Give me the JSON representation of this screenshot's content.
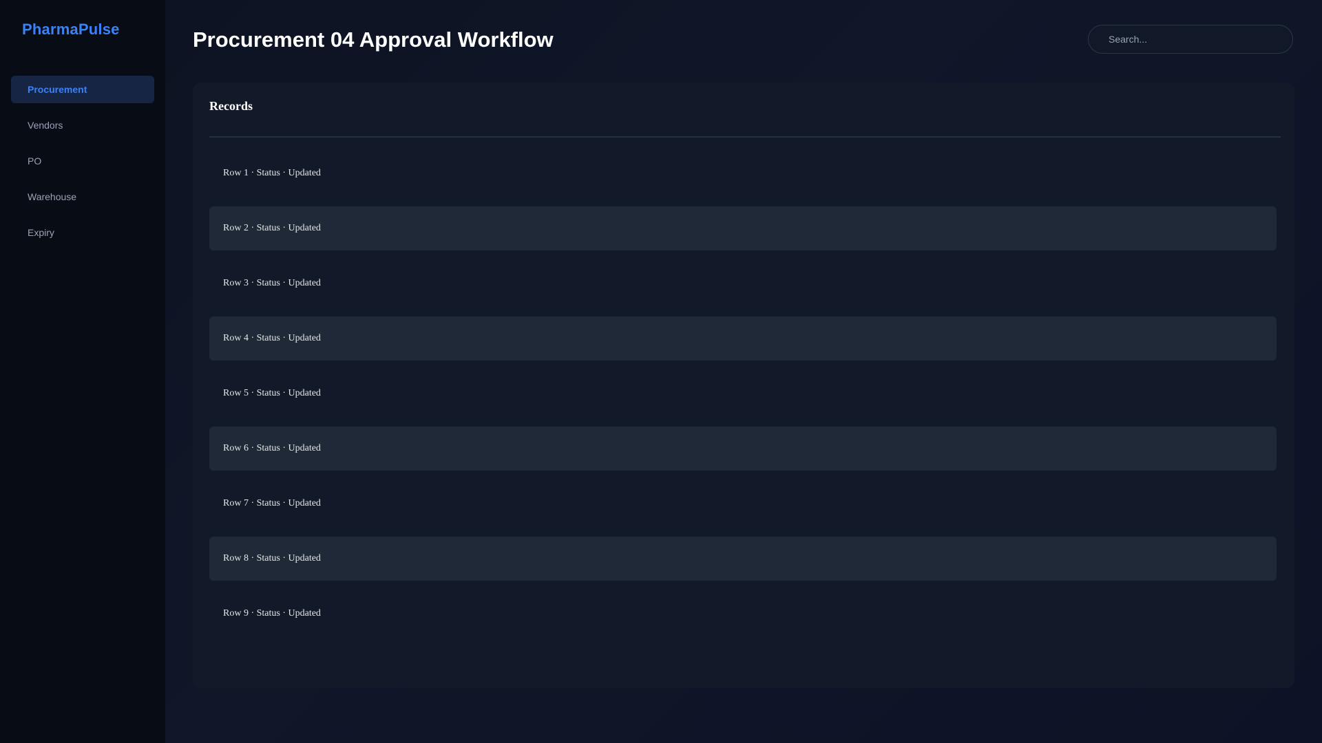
{
  "brand": "PharmaPulse",
  "sidebar": {
    "items": [
      {
        "label": "Procurement",
        "active": true
      },
      {
        "label": "Vendors",
        "active": false
      },
      {
        "label": "PO",
        "active": false
      },
      {
        "label": "Warehouse",
        "active": false
      },
      {
        "label": "Expiry",
        "active": false
      }
    ]
  },
  "header": {
    "title": "Procurement 04 Approval Workflow",
    "search_placeholder": "Search..."
  },
  "records": {
    "title": "Records",
    "rows": [
      "Row 1 · Status · Updated",
      "Row 2 · Status · Updated",
      "Row 3 · Status · Updated",
      "Row 4 · Status · Updated",
      "Row 5 · Status · Updated",
      "Row 6 · Status · Updated",
      "Row 7 · Status · Updated",
      "Row 8 · Status · Updated",
      "Row 9 · Status · Updated"
    ]
  },
  "colors": {
    "accent": "#3b82f6",
    "sidebar_bg": "#080c15",
    "panel_bg": "#121a29",
    "row_alt_bg": "#1f2937"
  }
}
